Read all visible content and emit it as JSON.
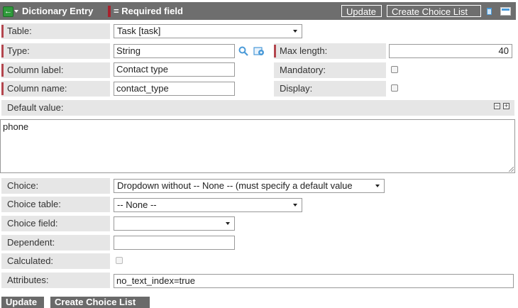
{
  "header": {
    "title": "Dictionary Entry",
    "required_note": "= Required field",
    "update_label": "Update",
    "create_choice_list_label": "Create Choice List"
  },
  "fields": {
    "table": {
      "label": "Table:",
      "value": "Task [task]"
    },
    "type": {
      "label": "Type:",
      "value": "String"
    },
    "max_length": {
      "label": "Max length:",
      "value": "40"
    },
    "column_label": {
      "label": "Column label:",
      "value": "Contact type"
    },
    "mandatory": {
      "label": "Mandatory:",
      "checked": false
    },
    "column_name": {
      "label": "Column name:",
      "value": "contact_type"
    },
    "display": {
      "label": "Display:",
      "checked": false
    },
    "default_value": {
      "label": "Default value:",
      "value": "phone"
    },
    "choice": {
      "label": "Choice:",
      "value": "Dropdown without -- None -- (must specify a default value"
    },
    "choice_table": {
      "label": "Choice table:",
      "value": "-- None --"
    },
    "choice_field": {
      "label": "Choice field:",
      "value": ""
    },
    "dependent": {
      "label": "Dependent:",
      "value": ""
    },
    "calculated": {
      "label": "Calculated:",
      "checked": false
    },
    "attributes": {
      "label": "Attributes:",
      "value": "no_text_index=true"
    }
  },
  "footer": {
    "update_label": "Update",
    "create_choice_list_label": "Create Choice List"
  },
  "colors": {
    "header_bg": "#6e6e6e",
    "label_bg": "#e6e6e6",
    "required_mark": "#a8212c",
    "icon_accent": "#4a9ad8"
  },
  "icons": [
    "back-arrow-icon",
    "search-icon",
    "reference-icon",
    "delete-icon",
    "form-icon",
    "collapse-icon",
    "expand-icon"
  ]
}
